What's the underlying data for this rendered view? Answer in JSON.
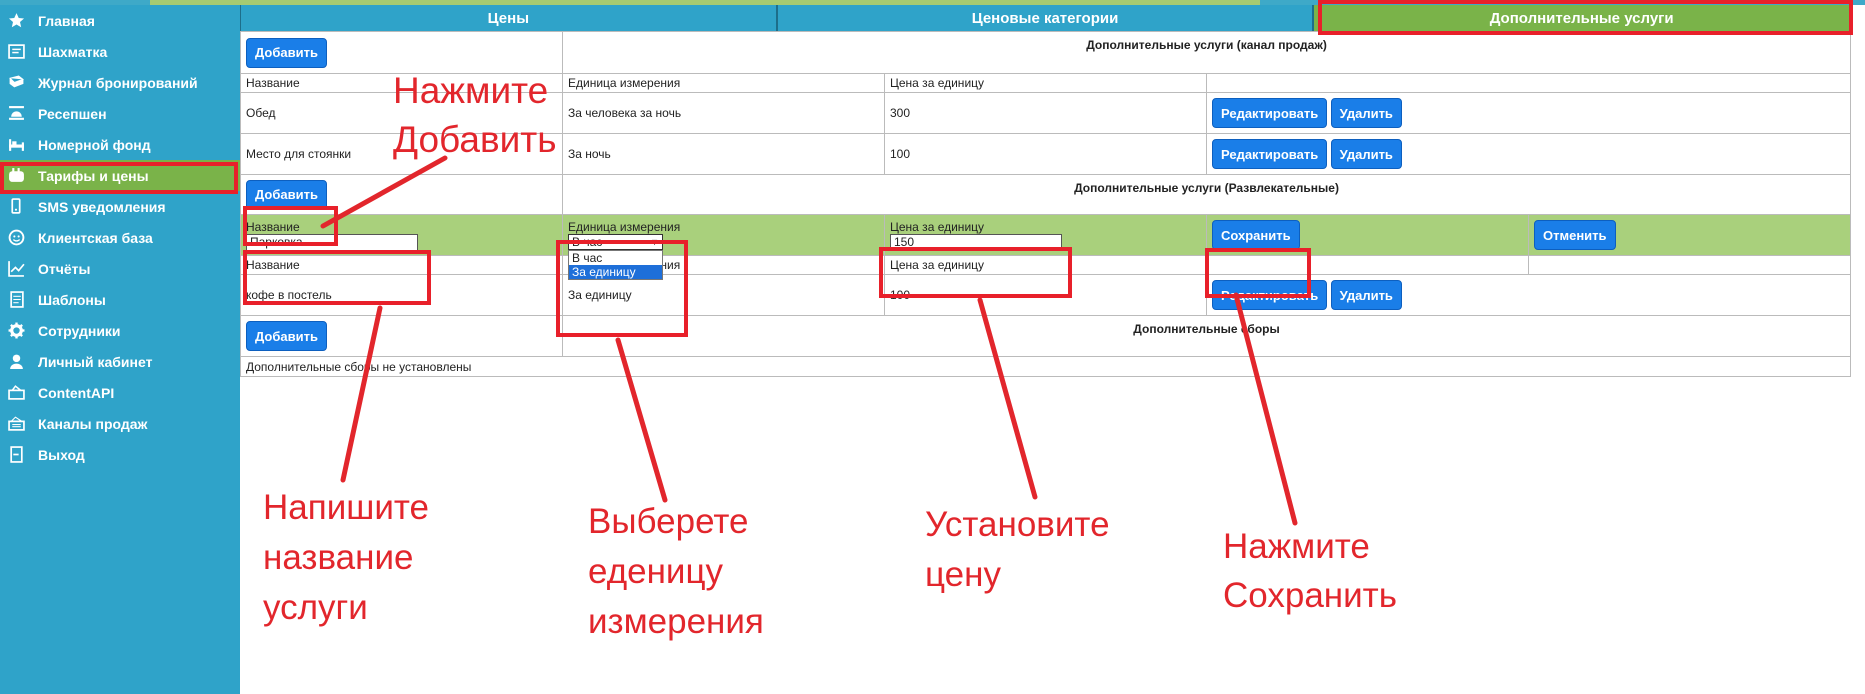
{
  "sidebar": {
    "items": [
      {
        "label": "Главная",
        "icon": "star-icon"
      },
      {
        "label": "Шахматка",
        "icon": "chessboard-icon"
      },
      {
        "label": "Журнал бронирований",
        "icon": "book-icon"
      },
      {
        "label": "Ресепшен",
        "icon": "reception-bell-icon"
      },
      {
        "label": "Номерной фонд",
        "icon": "bed-icon"
      },
      {
        "label": "Тарифы и цены",
        "icon": "wallet-icon",
        "active": true
      },
      {
        "label": "SMS уведомления",
        "icon": "mobile-icon"
      },
      {
        "label": "Клиентская база",
        "icon": "client-face-icon"
      },
      {
        "label": "Отчёты",
        "icon": "chart-icon"
      },
      {
        "label": "Шаблоны",
        "icon": "template-icon"
      },
      {
        "label": "Сотрудники",
        "icon": "gear-icon"
      },
      {
        "label": "Личный кабинет",
        "icon": "user-icon"
      },
      {
        "label": "ContentAPI",
        "icon": "api-icon"
      },
      {
        "label": "Каналы продаж",
        "icon": "channels-icon"
      },
      {
        "label": "Выход",
        "icon": "exit-icon"
      }
    ]
  },
  "tabs": [
    {
      "label": "Цены"
    },
    {
      "label": "Ценовые категории"
    },
    {
      "label": "Дополнительные услуги",
      "active": true
    }
  ],
  "buttons": {
    "add": "Добавить",
    "edit": "Редактировать",
    "delete": "Удалить",
    "save": "Сохранить",
    "cancel": "Отменить"
  },
  "sections": {
    "sales_channel": {
      "title": "Дополнительные услуги (канал продаж)",
      "headers": [
        "Название",
        "Единица измерения",
        "Цена за единицу"
      ],
      "rows": [
        {
          "name": "Обед",
          "unit": "За человека за ночь",
          "price": "300"
        },
        {
          "name": "Место для стоянки",
          "unit": "За ночь",
          "price": "100"
        }
      ]
    },
    "entertainment": {
      "title": "Дополнительные услуги (Развлекательные)",
      "edit_row": {
        "name_label": "Название",
        "name_value": "Парковка",
        "unit_label": "Единица измерения",
        "unit_value": "В час",
        "unit_options": [
          "В час",
          "За единицу"
        ],
        "price_label": "Цена за единицу",
        "price_value": "150"
      },
      "headers": [
        "Название",
        "Единица измерения",
        "Цена за единицу"
      ],
      "rows": [
        {
          "name": "кофе в постель",
          "unit": "За единицу",
          "price": "100"
        }
      ]
    },
    "fees": {
      "title": "Дополнительные сборы",
      "empty": "Дополнительные сборы не установлены"
    }
  },
  "annotations": {
    "click_add": "Нажмите\nДобавить",
    "write_name": "Напишите\nназвание\nуслуги",
    "select_unit": "Выберете\nеденицу\nизмерения",
    "set_price": "Установите\nцену",
    "click_save": "Нажмите\nСохранить"
  },
  "colors": {
    "sidebar": "#2fa3c9",
    "active": "#7ab349",
    "button": "#1a7ee8",
    "annotation": "#e2262c",
    "edit_row": "#a9d07c"
  }
}
